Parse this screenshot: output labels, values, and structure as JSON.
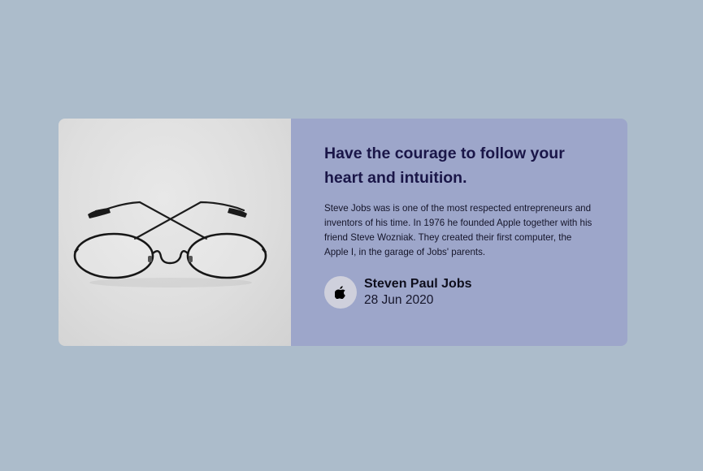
{
  "quote": {
    "title": "Have the courage to follow your heart and intuition.",
    "description": "Steve Jobs was is one of the most respected entrepreneurs and inventors of his time. In 1976 he founded Apple together with his friend Steve Wozniak. They created their first computer, the Apple I, in the garage of Jobs' parents.",
    "image_icon": "eyeglasses-photo"
  },
  "author": {
    "name": "Steven Paul Jobs",
    "date": "28 Jun 2020",
    "avatar_icon": "apple-logo-icon"
  },
  "colors": {
    "page_background": "#acbccb",
    "card_body_background": "#9da6ca",
    "title_color": "#1a1648",
    "avatar_background": "#cfd0dc"
  }
}
